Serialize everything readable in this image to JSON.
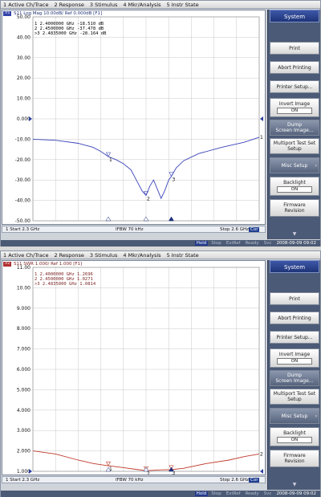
{
  "menu": [
    "1 Active Ch/Trace",
    "2 Response",
    "3 Stimulus",
    "4 Mkr/Analysis",
    "5 Instr State"
  ],
  "softkeys": {
    "title": "System",
    "print": "Print",
    "abort": "Abort Printing",
    "printer_setup": "Printer Setup...",
    "invert_image": "Invert Image",
    "invert_value": "ON",
    "dump_line1": "Dump",
    "dump_line2": "Screen Image...",
    "multiport_line1": "Multiport Test Set",
    "multiport_line2": "Setup",
    "misc": "Misc Setup",
    "backlight": "Backlight",
    "backlight_value": "ON",
    "firmware_line1": "Firmware",
    "firmware_line2": "Revision"
  },
  "panels": [
    {
      "trace_box": "Tr1",
      "trace_header": "S11 Log Mag 10.00dB/ Ref 0.000dB [F1]",
      "trace_color": "#3a44b8",
      "y_ticks": [
        "50.00",
        "40.00",
        "30.00",
        "20.00",
        "10.00",
        "0.000",
        "-10.00",
        "-20.00",
        "-30.00",
        "-40.00",
        "-50.00"
      ],
      "markers": [
        "1  2.4000000 GHz -18.510 dB",
        "2  2.4500000 GHz -37.478 dB",
        ">3  2.4835000 GHz -28.164 dB"
      ],
      "start": "1  Start 2.3 GHz",
      "ifbw": "IFBW 70 kHz",
      "stop": "Stop 2.6 GHz",
      "cor": "Cor"
    },
    {
      "trace_box": "Tr2",
      "trace_header": "S11 SWR 1.000/ Ref 1.000 [F1]",
      "trace_color": "#c0392b",
      "y_ticks": [
        "11.00",
        "10.00",
        "9.000",
        "8.000",
        "7.000",
        "6.000",
        "5.000",
        "4.000",
        "3.000",
        "2.000",
        "1.000"
      ],
      "markers": [
        "1  2.4000000 GHz 1.2696",
        "2  2.4500000 GHz 1.0271",
        ">3  2.4835000 GHz 1.0814"
      ],
      "start": "1  Start 2.3 GHz",
      "ifbw": "IFBW 70 kHz",
      "stop": "Stop 2.6 GHz",
      "cor": "Cor"
    }
  ],
  "status": {
    "hold": "Hold",
    "stop": "Stop",
    "extref": "ExtRef",
    "ready": "Ready",
    "svc": "Svc",
    "time": "2008-09-09 09:02"
  },
  "chart_data": [
    {
      "type": "line",
      "x": [
        2.3,
        2.33,
        2.36,
        2.38,
        2.39,
        2.4,
        2.41,
        2.42,
        2.43,
        2.44,
        2.445,
        2.45,
        2.455,
        2.46,
        2.47,
        2.475,
        2.48,
        2.4835,
        2.49,
        2.5,
        2.52,
        2.55,
        2.58,
        2.6
      ],
      "series": [
        {
          "values": [
            -10.0,
            -10.5,
            -12.0,
            -14.0,
            -16.0,
            -18.5,
            -20.0,
            -22.0,
            -25.0,
            -32.0,
            -35.5,
            -37.5,
            -33.0,
            -30.0,
            -39.0,
            -35.0,
            -30.0,
            -28.2,
            -24.0,
            -20.5,
            -17.0,
            -14.0,
            -11.5,
            -9.0
          ]
        }
      ],
      "ylim": [
        -50,
        50
      ],
      "xlim": [
        2.3,
        2.6
      ],
      "grid": true,
      "marker_x": [
        2.4,
        2.45,
        2.4835
      ]
    },
    {
      "type": "line",
      "x": [
        2.3,
        2.33,
        2.36,
        2.38,
        2.4,
        2.42,
        2.44,
        2.45,
        2.46,
        2.47,
        2.4835,
        2.5,
        2.53,
        2.56,
        2.58,
        2.6
      ],
      "series": [
        {
          "values": [
            2.0,
            1.85,
            1.55,
            1.38,
            1.27,
            1.18,
            1.08,
            1.03,
            1.05,
            1.07,
            1.08,
            1.15,
            1.38,
            1.55,
            1.72,
            1.85
          ]
        }
      ],
      "ylim": [
        1,
        11
      ],
      "xlim": [
        2.3,
        2.6
      ],
      "grid": true,
      "marker_x": [
        2.4,
        2.45,
        2.4835
      ]
    }
  ]
}
